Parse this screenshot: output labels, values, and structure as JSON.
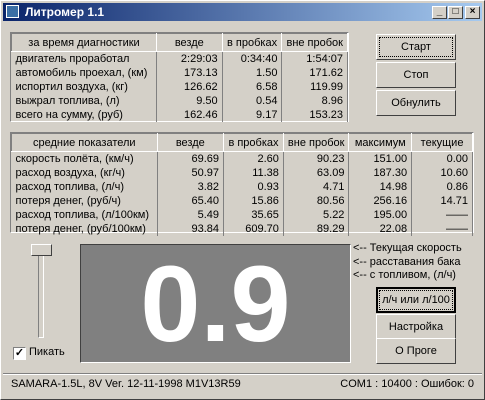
{
  "window": {
    "title": "Литромер 1.1"
  },
  "table1": {
    "headers": [
      "за время диагностики",
      "везде",
      "в пробках",
      "вне пробок"
    ],
    "rows": [
      [
        "двигатель проработал",
        "2:29:03",
        "0:34:40",
        "1:54:07"
      ],
      [
        "автомобиль проехал, (км)",
        "173.13",
        "1.50",
        "171.62"
      ],
      [
        "испортил воздуха, (кг)",
        "126.62",
        "6.58",
        "119.99"
      ],
      [
        "выжрал топлива, (л)",
        "9.50",
        "0.54",
        "8.96"
      ],
      [
        "всего на сумму, (руб)",
        "162.46",
        "9.17",
        "153.23"
      ]
    ]
  },
  "table2": {
    "headers": [
      "средние показатели",
      "везде",
      "в пробках",
      "вне пробок",
      "максимум",
      "текущие"
    ],
    "rows": [
      [
        "скорость полёта, (км/ч)",
        "69.69",
        "2.60",
        "90.23",
        "151.00",
        "0.00"
      ],
      [
        "расход воздуха, (кг/ч)",
        "50.97",
        "11.38",
        "63.09",
        "187.30",
        "10.60"
      ],
      [
        "расход топлива, (л/ч)",
        "3.82",
        "0.93",
        "4.71",
        "14.98",
        "0.86"
      ],
      [
        "потеря денег, (руб/ч)",
        "65.40",
        "15.86",
        "80.56",
        "256.16",
        "14.71"
      ],
      [
        "расход топлива, (л/100км)",
        "5.49",
        "35.65",
        "5.22",
        "195.00",
        "——"
      ],
      [
        "потеря денег, (руб/100км)",
        "93.84",
        "609.70",
        "89.29",
        "22.08",
        "——"
      ]
    ]
  },
  "buttons": {
    "start": "Старт",
    "stop": "Стоп",
    "reset": "Обнулить",
    "units": "л/ч или л/100",
    "settings": "Настройка",
    "about": "О Проге"
  },
  "display": {
    "value": "0.9"
  },
  "legend": [
    "<-- Текущая скорость",
    "<-- расставания бака",
    "<--  с топливом, (л/ч)"
  ],
  "beep": {
    "label": "Пикать",
    "checked": true,
    "check_glyph": "✓"
  },
  "status": {
    "left": "SAMARA-1.5L, 8V Ver. 12-11-1998  M1V13R59",
    "right": "COM1 : 10400 : Ошибок: 0"
  }
}
